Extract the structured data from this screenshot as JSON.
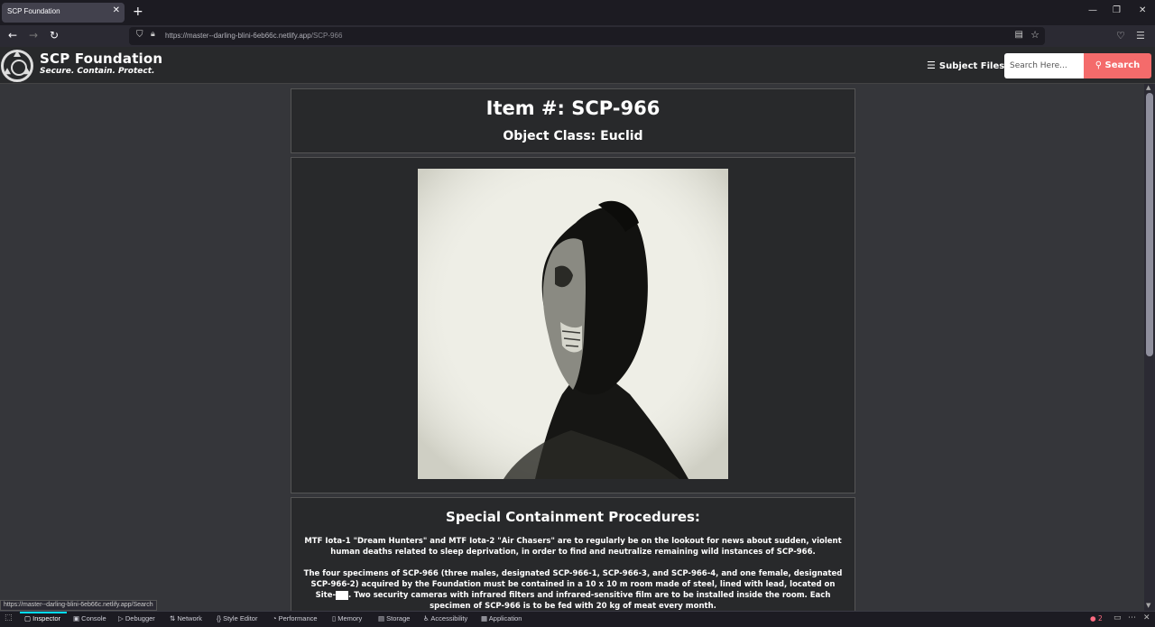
{
  "browser": {
    "tab_title": "SCP Foundation",
    "url_origin": "https://master--darling-blini-6eb66c.netlify.app",
    "url_path": "/SCP-966",
    "status_link": "https://master--darling-blini-6eb66c.netlify.app/Search"
  },
  "header": {
    "brand_title": "SCP Foundation",
    "brand_slogan": "Secure. Contain. Protect.",
    "nav_link": "Subject Files",
    "search_placeholder": "Search Here...",
    "search_button": "Search"
  },
  "article": {
    "item_title": "Item #: SCP-966",
    "object_class": "Object Class: Euclid",
    "section_title": "Special Containment Procedures:",
    "paragraph1": "MTF Iota-1 \"Dream Hunters\" and MTF Iota-2 \"Air Chasers\" are to regularly be on the lookout for news about sudden, violent human deaths related to sleep deprivation, in order to find and neutralize remaining wild instances of SCP-966.",
    "paragraph2_a": "The four specimens of SCP-966 (three males, designated SCP-966-1, SCP-966-3, and SCP-966-4, and one female, designated SCP-966-2) acquired by the Foundation must be contained in a 10 x 10 m room made of steel, lined with lead, located on Site-",
    "paragraph2_b": ". Two security cameras with infrared filters and infrared-sensitive film are to be installed inside the room. Each specimen of SCP-966 is to be fed with 20 kg of meat every month."
  },
  "devtools": {
    "tabs": [
      "Inspector",
      "Console",
      "Debugger",
      "Network",
      "Style Editor",
      "Performance",
      "Memory",
      "Storage",
      "Accessibility",
      "Application"
    ],
    "error_count": "2"
  },
  "colors": {
    "accent": "#f46b6b",
    "header_bg": "#28292b",
    "page_bg": "#35363a"
  }
}
